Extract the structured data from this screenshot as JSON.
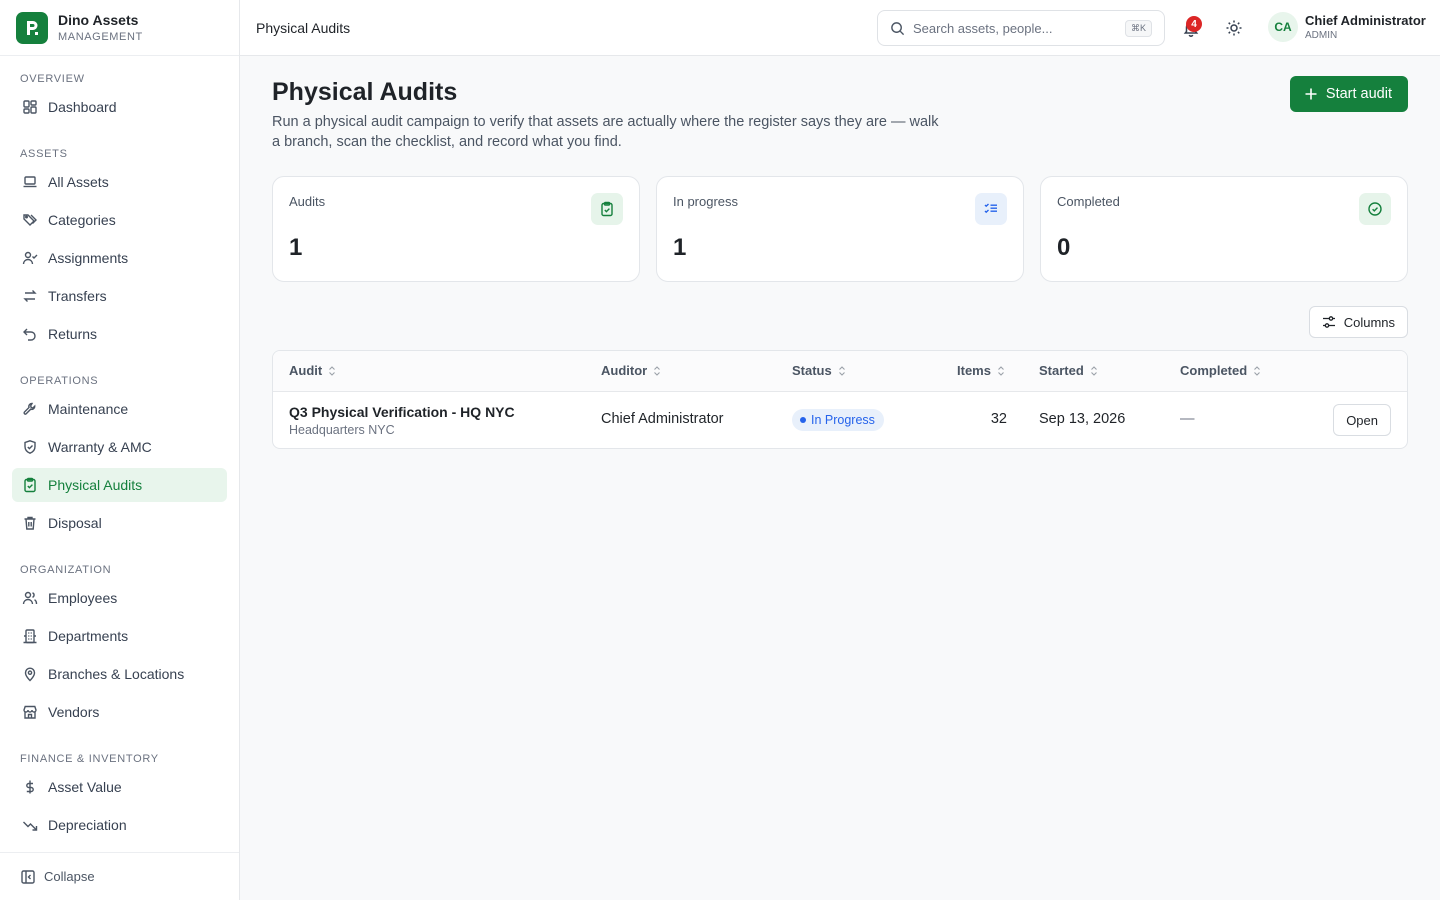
{
  "brand": {
    "name": "Dino Assets",
    "subtitle": "MANAGEMENT"
  },
  "sidebar": {
    "sections": [
      {
        "label": "OVERVIEW",
        "items": [
          {
            "label": "Dashboard",
            "icon": "dashboard-icon"
          }
        ]
      },
      {
        "label": "ASSETS",
        "items": [
          {
            "label": "All Assets",
            "icon": "laptop-icon"
          },
          {
            "label": "Categories",
            "icon": "tags-icon"
          },
          {
            "label": "Assignments",
            "icon": "user-check-icon"
          },
          {
            "label": "Transfers",
            "icon": "arrows-icon"
          },
          {
            "label": "Returns",
            "icon": "undo-icon"
          }
        ]
      },
      {
        "label": "OPERATIONS",
        "items": [
          {
            "label": "Maintenance",
            "icon": "wrench-icon"
          },
          {
            "label": "Warranty & AMC",
            "icon": "shield-icon"
          },
          {
            "label": "Physical Audits",
            "icon": "clipboard-check-icon",
            "active": true
          },
          {
            "label": "Disposal",
            "icon": "trash-icon"
          }
        ]
      },
      {
        "label": "ORGANIZATION",
        "items": [
          {
            "label": "Employees",
            "icon": "users-icon"
          },
          {
            "label": "Departments",
            "icon": "building-icon"
          },
          {
            "label": "Branches & Locations",
            "icon": "map-pin-icon"
          },
          {
            "label": "Vendors",
            "icon": "store-icon"
          }
        ]
      },
      {
        "label": "FINANCE & INVENTORY",
        "items": [
          {
            "label": "Asset Value",
            "icon": "dollar-icon"
          },
          {
            "label": "Depreciation",
            "icon": "trending-down-icon"
          }
        ]
      }
    ],
    "collapse_label": "Collapse"
  },
  "topbar": {
    "breadcrumb": "Physical Audits",
    "search_placeholder": "Search assets, people...",
    "search_shortcut": "⌘K",
    "notification_count": "4",
    "user": {
      "initials": "CA",
      "name": "Chief Administrator",
      "role": "ADMIN"
    }
  },
  "page": {
    "title": "Physical Audits",
    "description": "Run a physical audit campaign to verify that assets are actually where the register says they are — walk a branch, scan the checklist, and record what you find.",
    "start_button": "Start audit",
    "columns_button": "Columns"
  },
  "stats": [
    {
      "label": "Audits",
      "value": "1",
      "icon": "clipboard-check-icon",
      "tone": "green"
    },
    {
      "label": "In progress",
      "value": "1",
      "icon": "list-checks-icon",
      "tone": "blue"
    },
    {
      "label": "Completed",
      "value": "0",
      "icon": "check-circle-icon",
      "tone": "green"
    }
  ],
  "table": {
    "headers": [
      "Audit",
      "Auditor",
      "Status",
      "Items",
      "Started",
      "Completed"
    ],
    "rows": [
      {
        "audit": "Q3 Physical Verification - HQ NYC",
        "location": "Headquarters NYC",
        "auditor": "Chief Administrator",
        "status": "In Progress",
        "items": "32",
        "started": "Sep 13, 2026",
        "completed": "—",
        "action": "Open"
      }
    ]
  },
  "colors": {
    "accent": "#15803d",
    "accent_soft": "#e8f5ec",
    "status_blue": "#2563eb",
    "badge_red": "#dc2626"
  }
}
